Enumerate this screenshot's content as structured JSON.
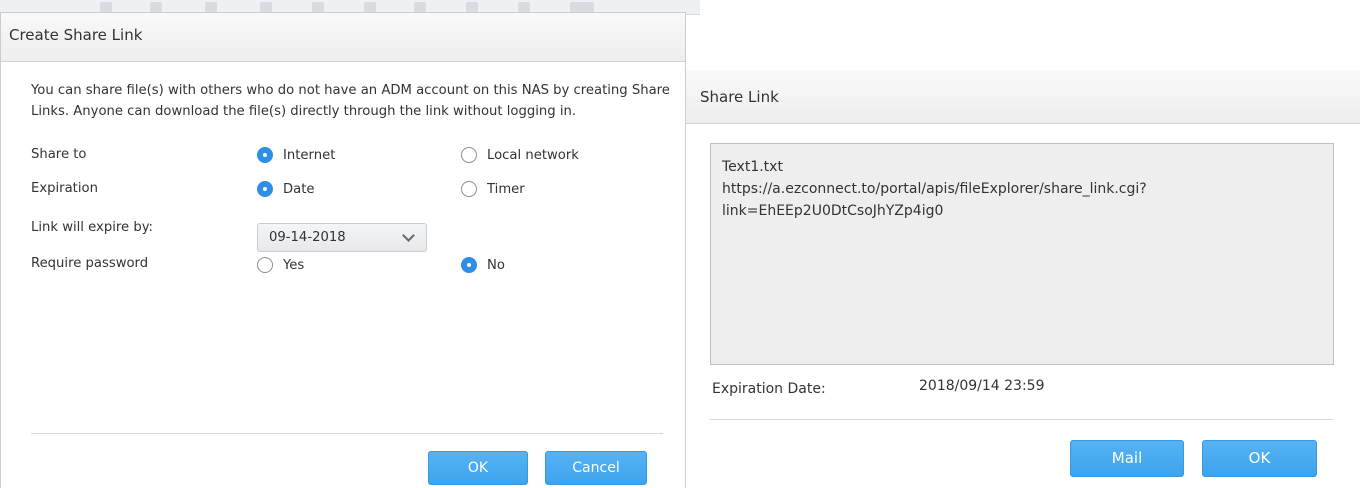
{
  "create_dialog": {
    "title": "Create Share Link",
    "intro_line1": "You can share file(s) with others who do not have an ADM account on this NAS by creating Share",
    "intro_line2": "Links. Anyone can download the file(s) directly through the link without logging in.",
    "share_to": {
      "label": "Share to",
      "options": [
        "Internet",
        "Local network"
      ],
      "selected": "Internet"
    },
    "expiration": {
      "label": "Expiration",
      "options": [
        "Date",
        "Timer"
      ],
      "selected": "Date"
    },
    "expire_by": {
      "label": "Link will expire by:",
      "value": "09-14-2018"
    },
    "require_password": {
      "label": "Require password",
      "options": [
        "Yes",
        "No"
      ],
      "selected": "No"
    },
    "ok_label": "OK",
    "cancel_label": "Cancel"
  },
  "share_dialog": {
    "title": "Share Link",
    "link_lines": [
      "Text1.txt",
      "https://a.ezconnect.to/portal/apis/fileExplorer/share_link.cgi?",
      "link=EhEEp2U0DtCsoJhYZp4ig0"
    ],
    "expiration_label": "Expiration Date:",
    "expiration_value": "2018/09/14 23:59",
    "mail_label": "Mail",
    "ok_label": "OK"
  },
  "colors": {
    "accent": "#3ea4ee",
    "radio_selected": "#2d8ee8",
    "link_box_bg": "#eeeeee"
  },
  "icons": {
    "dropdown": "chevron-down-icon",
    "radio_on": "radio-selected-icon",
    "radio_off": "radio-unselected-icon"
  }
}
